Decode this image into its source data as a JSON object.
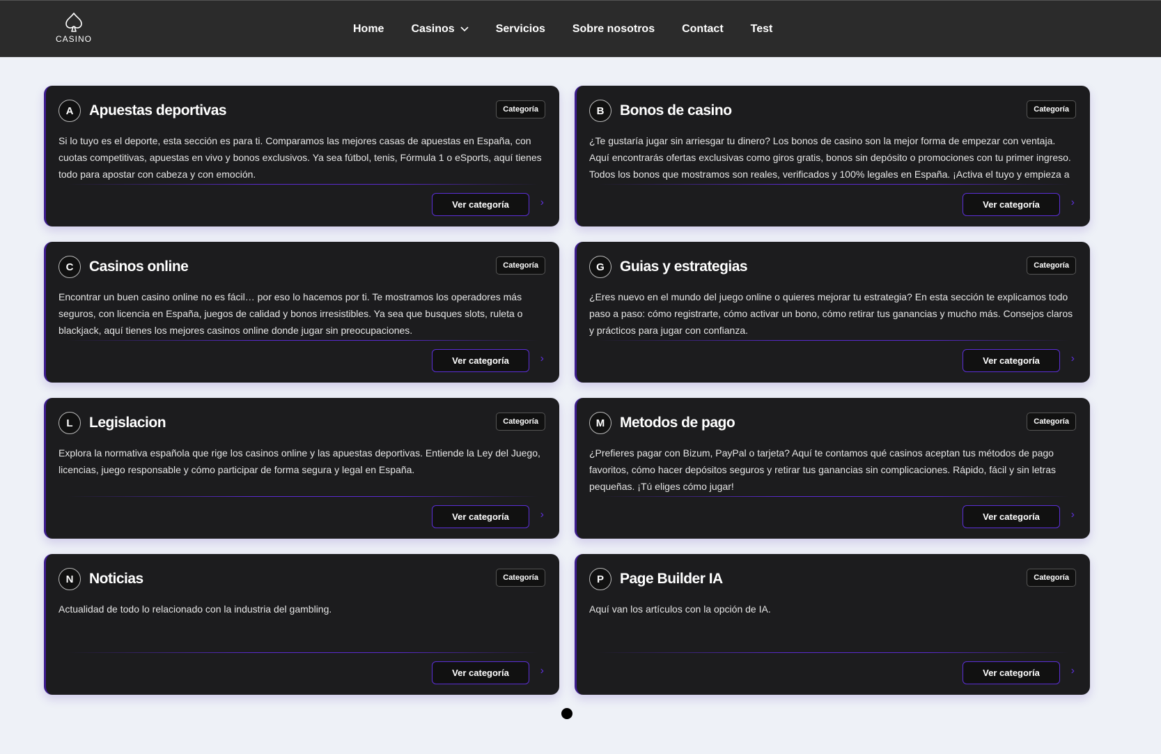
{
  "header": {
    "logo_text": "CASINO",
    "nav": [
      {
        "label": "Home"
      },
      {
        "label": "Casinos"
      },
      {
        "label": "Servicios"
      },
      {
        "label": "Sobre nosotros"
      },
      {
        "label": "Contact"
      },
      {
        "label": "Test"
      }
    ]
  },
  "cards": [
    {
      "letter": "A",
      "title": "Apuestas deportivas",
      "badge": "Categoría",
      "description": "Si lo tuyo es el deporte, esta sección es para ti. Comparamos las mejores casas de apuestas en España, con cuotas competitivas, apuestas en vivo y bonos exclusivos. Ya sea fútbol, tenis, Fórmula 1 o eSports, aquí tienes todo para apostar con cabeza y con emoción.",
      "button": "Ver categoría",
      "arrow": "›"
    },
    {
      "letter": "B",
      "title": "Bonos de casino",
      "badge": "Categoría",
      "description": "¿Te gustaría jugar sin arriesgar tu dinero? Los bonos de casino son la mejor forma de empezar con ventaja. Aquí encontrarás ofertas exclusivas como giros gratis, bonos sin depósito o promociones con tu primer ingreso. Todos los bonos que mostramos son reales, verificados y 100% legales en España. ¡Activa el tuyo y empieza a ganar...",
      "button": "Ver categoría",
      "arrow": "›"
    },
    {
      "letter": "C",
      "title": "Casinos online",
      "badge": "Categoría",
      "description": "Encontrar un buen casino online no es fácil… por eso lo hacemos por ti. Te mostramos los operadores más seguros, con licencia en España, juegos de calidad y bonos irresistibles. Ya sea que busques slots, ruleta o blackjack, aquí tienes los mejores casinos online donde jugar sin preocupaciones.",
      "button": "Ver categoría",
      "arrow": "›"
    },
    {
      "letter": "G",
      "title": "Guias y estrategias",
      "badge": "Categoría",
      "description": "¿Eres nuevo en el mundo del juego online o quieres mejorar tu estrategia? En esta sección te explicamos todo paso a paso: cómo registrarte, cómo activar un bono, cómo retirar tus ganancias y mucho más. Consejos claros y prácticos para jugar con confianza.",
      "button": "Ver categoría",
      "arrow": "›"
    },
    {
      "letter": "L",
      "title": "Legislacion",
      "badge": "Categoría",
      "description": "Explora la normativa española que rige los casinos online y las apuestas deportivas. Entiende la Ley del Juego, licencias, juego responsable y cómo participar de forma segura y legal en España.",
      "button": "Ver categoría",
      "arrow": "›"
    },
    {
      "letter": "M",
      "title": "Metodos de pago",
      "badge": "Categoría",
      "description": "¿Prefieres pagar con Bizum, PayPal o tarjeta? Aquí te contamos qué casinos aceptan tus métodos de pago favoritos, cómo hacer depósitos seguros y retirar tus ganancias sin complicaciones. Rápido, fácil y sin letras pequeñas. ¡Tú eliges cómo jugar!",
      "button": "Ver categoría",
      "arrow": "›"
    },
    {
      "letter": "N",
      "title": "Noticias",
      "badge": "Categoría",
      "description": "Actualidad de todo lo relacionado con la industria del gambling.",
      "button": "Ver categoría",
      "arrow": "›"
    },
    {
      "letter": "P",
      "title": "Page Builder IA",
      "badge": "Categoría",
      "description": "Aquí van los artículos con la opción de IA.",
      "button": "Ver categoría",
      "arrow": "›"
    }
  ],
  "pagination": {
    "current": 1
  }
}
